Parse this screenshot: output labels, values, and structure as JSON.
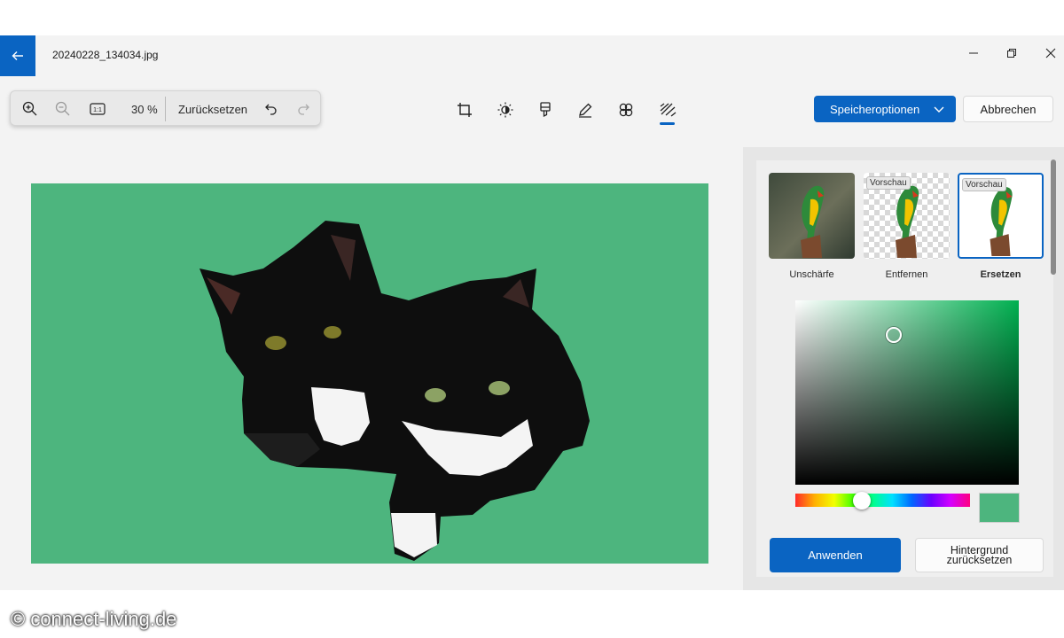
{
  "window": {
    "file_name": "20240228_134034.jpg",
    "back_icon": "arrow-left-icon",
    "controls": [
      "minimize-icon",
      "restore-icon",
      "close-icon"
    ]
  },
  "zoom_toolbar": {
    "zoom_level": "30 %",
    "reset_label": "Zurücksetzen",
    "icons": [
      "zoom-in-icon",
      "zoom-out-icon",
      "actual-size-icon",
      "undo-icon",
      "redo-icon"
    ]
  },
  "edit_tools": {
    "icons": [
      "crop-icon",
      "brightness-icon",
      "markup-icon",
      "draw-icon",
      "filter-icon",
      "background-icon"
    ],
    "active": "background-icon"
  },
  "actions": {
    "save_options_label": "Speicheroptionen",
    "cancel_label": "Abbrechen"
  },
  "background_panel": {
    "options": [
      {
        "label": "Unschärfe",
        "badge": "",
        "selected": false
      },
      {
        "label": "Entfernen",
        "badge": "Vorschau",
        "selected": false
      },
      {
        "label": "Ersetzen",
        "badge": "Vorschau",
        "selected": true
      }
    ],
    "selected_color": "#4db57e",
    "hue_color": "#00b050",
    "apply_label": "Anwenden",
    "reset_background_label_line1": "Hintergrund",
    "reset_background_label_line2": "zurücksetzen"
  },
  "colors": {
    "accent": "#0a64c2",
    "canvas_background": "#4db57e"
  },
  "watermark": "© connect-living.de"
}
